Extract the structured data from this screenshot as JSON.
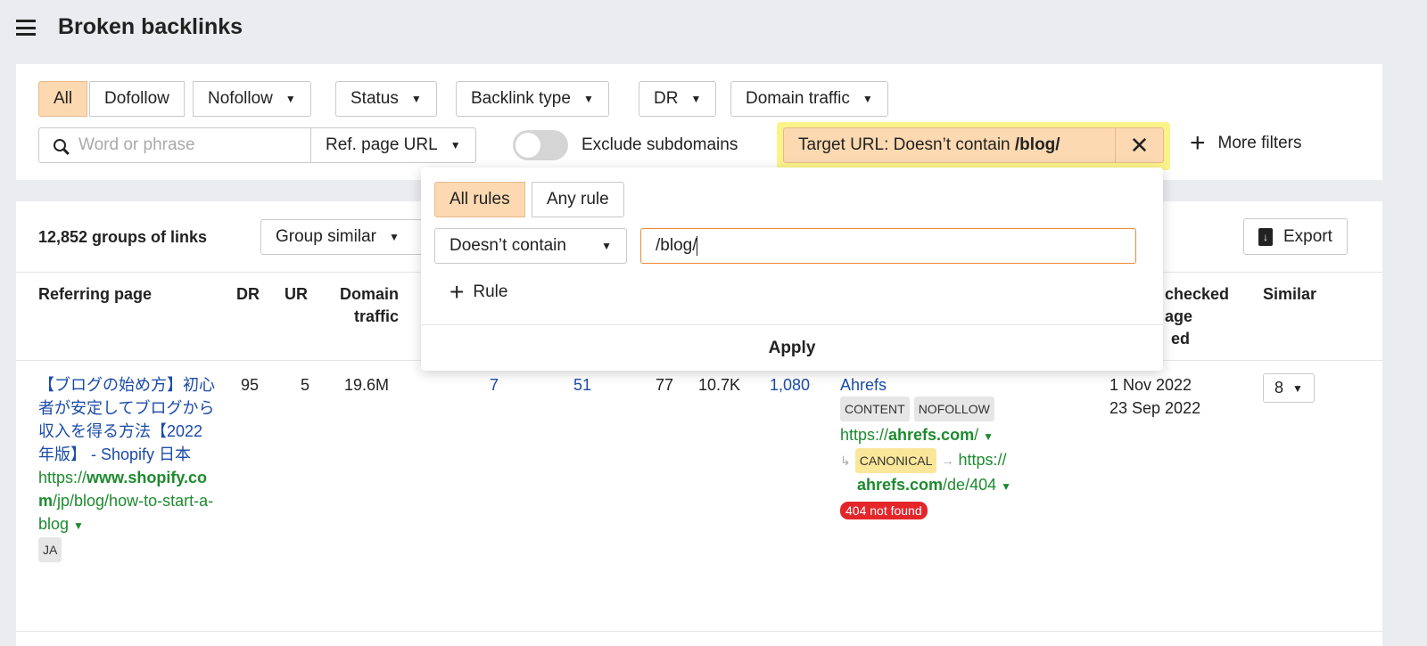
{
  "header": {
    "title": "Broken backlinks"
  },
  "filters": {
    "all": "All",
    "dofollow": "Dofollow",
    "nofollow": "Nofollow",
    "status": "Status",
    "backlink_type": "Backlink type",
    "dr": "DR",
    "domain_traffic": "Domain traffic",
    "search_placeholder": "Word or phrase",
    "ref_page_url": "Ref. page URL",
    "exclude_subdomains": "Exclude subdomains",
    "target_prefix": "Target URL: Doesn’t contain ",
    "target_value": "/blog/",
    "more_filters": "More filters"
  },
  "popover": {
    "all_rules": "All rules",
    "any_rule": "Any rule",
    "condition": "Doesn’t contain",
    "input_value": "/blog/",
    "add_rule": "Rule",
    "apply": "Apply"
  },
  "toolbar": {
    "count": "12,852 groups of links",
    "group_similar": "Group similar",
    "export": "Export"
  },
  "columns": {
    "referring_page": "Referring page",
    "dr": "DR",
    "ur": "UR",
    "domain_traffic_1": "Domain",
    "domain_traffic_2": "traffic",
    "checked_1": "checked",
    "checked_2": "age",
    "checked_3": "ed",
    "similar": "Similar"
  },
  "row": {
    "title": "【ブログの始め方】初心者が安定してブログから収入を得る方法【2022年版】 - Shopify 日本",
    "url_prefix": "https://",
    "url_domain": "www.shopify.com",
    "url_path": "/jp/blog/how-to-start-a-blog",
    "lang": "JA",
    "dr": "95",
    "ur": "5",
    "domain_traffic": "19.6M",
    "c1": "7",
    "c2": "51",
    "c3": "77",
    "c4": "10.7K",
    "c5": "1,080",
    "anchor": "Ahrefs",
    "tag1": "CONTENT",
    "tag2": "NOFOLLOW",
    "target_prefix": "https://",
    "target_domain": "ahrefs.com",
    "target_path": "/",
    "canonical": "CANONICAL",
    "canon_prefix": "https://",
    "canon_domain": "ahrefs.com",
    "canon_path": "/de/404",
    "status": "404 not found",
    "date1": "1 Nov 2022",
    "date2": "23 Sep 2022",
    "similar": "8"
  }
}
